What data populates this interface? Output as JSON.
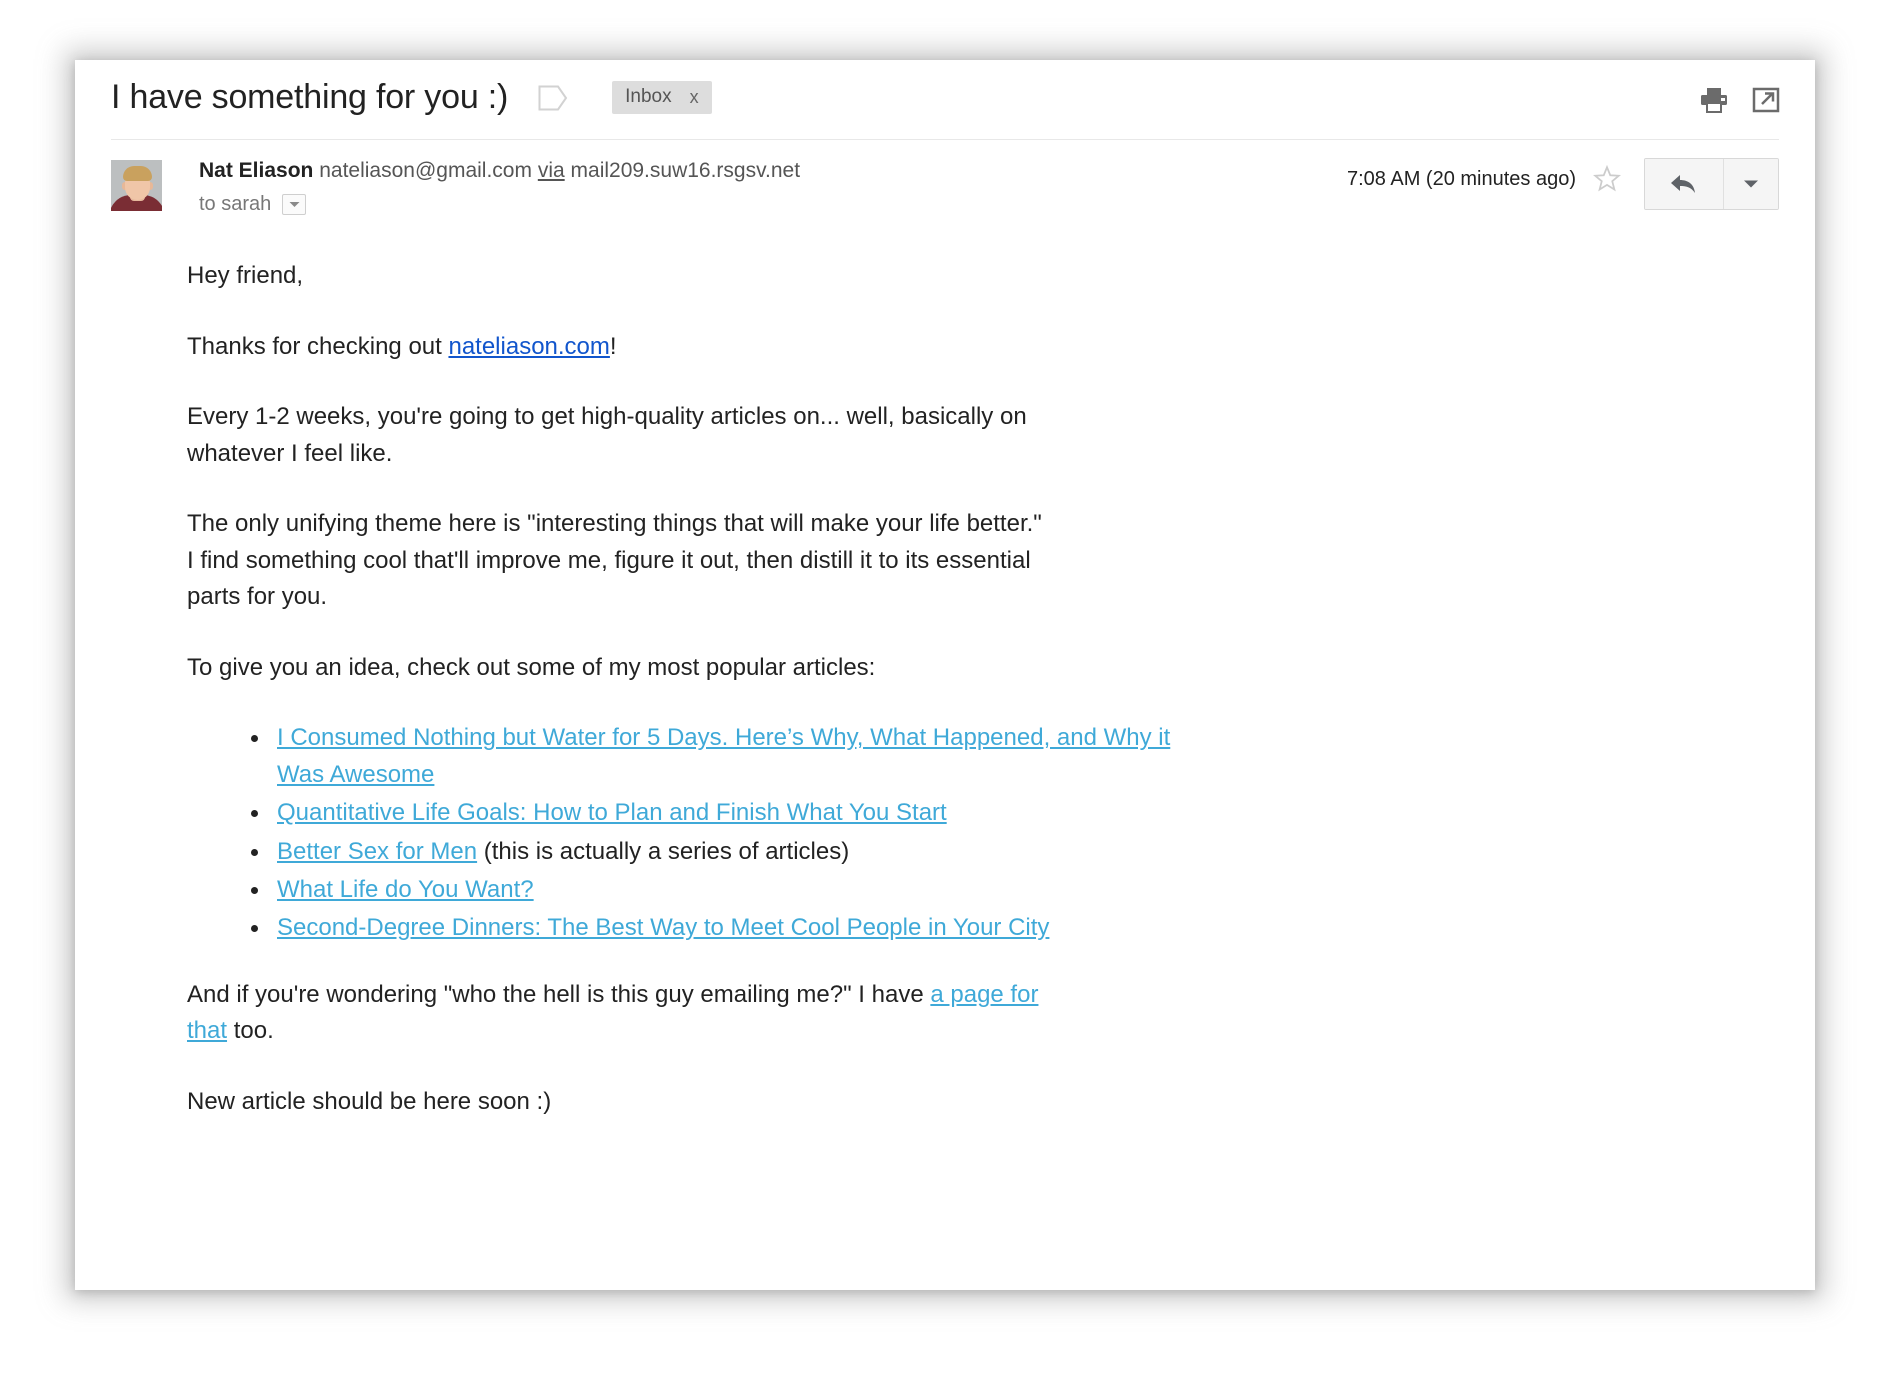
{
  "header": {
    "subject": "I have something for you :)",
    "label_chip": "Inbox",
    "label_chip_remove": "x",
    "print_icon": "print-icon",
    "popout_icon": "open-in-new-window-icon",
    "tag_icon": "label-tag-icon"
  },
  "message": {
    "sender_name": "Nat Eliason",
    "sender_email": "nateliason@gmail.com",
    "via_label": "via",
    "via_host": "mail209.suw16.rsgsv.net",
    "recipient": "to sarah",
    "timestamp": "7:08 AM (20 minutes ago)",
    "star_icon": "star-outline-icon",
    "reply_icon": "reply-arrow-icon",
    "more_icon": "chevron-down-icon",
    "recipient_caret_icon": "chevron-down-icon"
  },
  "body": {
    "greeting": "Hey friend,",
    "thanks_prefix": "Thanks for checking out ",
    "thanks_link": "nateliason.com",
    "thanks_suffix": "!",
    "para_cadence": "Every 1-2 weeks, you're going to get high-quality articles on... well, basically on whatever I feel like.",
    "para_theme": "The only unifying theme here is \"interesting things that will make your life better.\" I find something cool that'll improve me, figure it out, then distill it to its essential parts for you.",
    "para_intro_list": "To give you an idea, check out some of my most popular articles:",
    "articles": [
      {
        "link": "I Consumed Nothing but Water for 5 Days. Here’s Why, What Happened, and Why it Was Awesome",
        "trailing": ""
      },
      {
        "link": "Quantitative Life Goals: How to Plan and Finish What You Start",
        "trailing": ""
      },
      {
        "link": "Better Sex for Men",
        "trailing": " (this is actually a series of articles)"
      },
      {
        "link": "What Life do You Want?",
        "trailing": ""
      },
      {
        "link": "Second-Degree Dinners: The Best Way to Meet Cool People in Your City",
        "trailing": ""
      }
    ],
    "para_who_prefix": "And if you're wondering \"who the hell is this guy emailing me?\" I have ",
    "para_who_link": "a page for that",
    "para_who_suffix": " too.",
    "para_closing": "New article should be here soon :)"
  },
  "colors": {
    "link_cyan": "#3fa9d8",
    "link_blue": "#1155cc",
    "chip_bg": "#dddddd",
    "text": "#222222"
  }
}
